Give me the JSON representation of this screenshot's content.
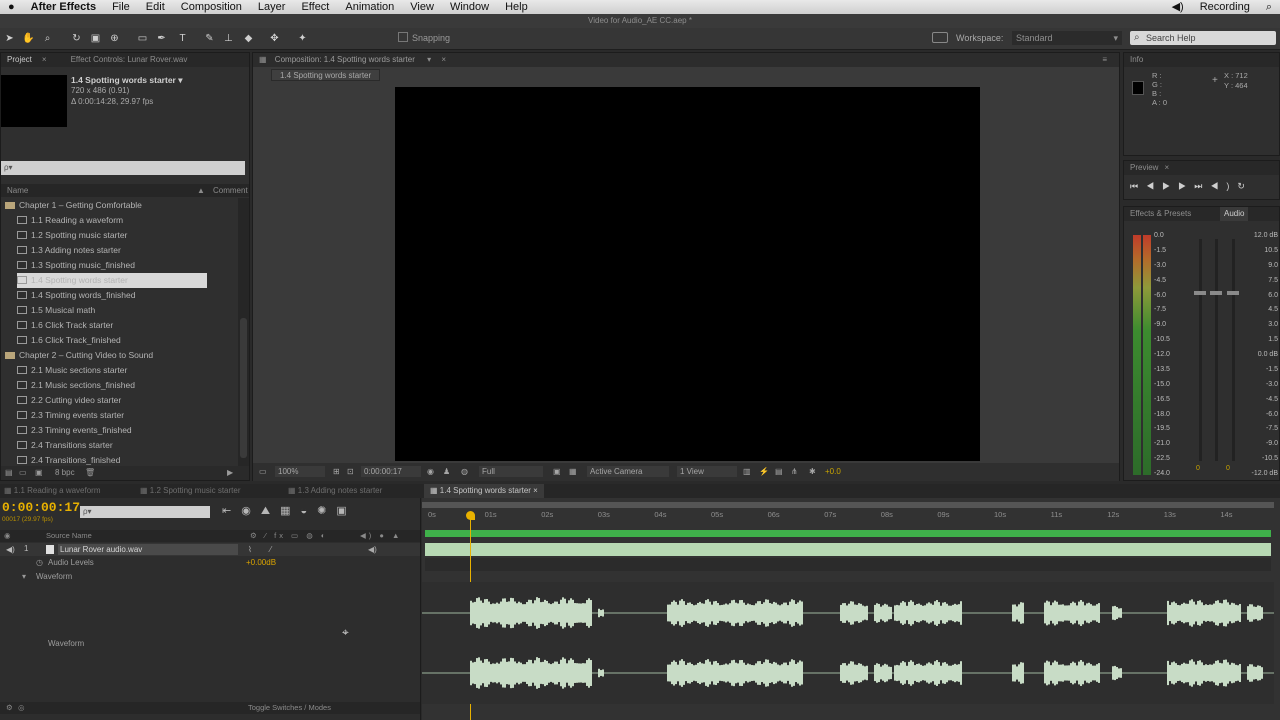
{
  "menu": {
    "apple": "",
    "app": "After Effects",
    "file": "File",
    "edit": "Edit",
    "composition": "Composition",
    "layer": "Layer",
    "effect": "Effect",
    "animation": "Animation",
    "view": "View",
    "window": "Window",
    "help": "Help",
    "recording": "Recording"
  },
  "window_title": "Video for Audio_AE CC.aep *",
  "toolbar": {
    "snapping": "Snapping",
    "workspace_label": "Workspace:",
    "workspace_value": "Standard",
    "search_placeholder": "Search Help"
  },
  "project": {
    "tab": "Project",
    "effect_tab": "Effect Controls: Lunar Rover.wav",
    "item_name": "1.4 Spotting words starter ▾",
    "item_size": "720 x 486 (0.91)",
    "item_duration": "Δ 0:00:14:28, 29.97 fps",
    "search_placeholder": "ρ▾",
    "col_name": "Name",
    "col_comment": "Comment",
    "items": [
      {
        "label": "Chapter 1 – Getting Comfortable",
        "type": "folder"
      },
      {
        "label": "1.1 Reading a waveform",
        "type": "comp"
      },
      {
        "label": "1.2 Spotting music starter",
        "type": "comp"
      },
      {
        "label": "1.3 Adding notes starter",
        "type": "comp"
      },
      {
        "label": "1.3 Spotting music_finished",
        "type": "comp"
      },
      {
        "label": "1.4 Spotting words starter",
        "type": "comp",
        "selected": true
      },
      {
        "label": "1.4 Spotting words_finished",
        "type": "comp"
      },
      {
        "label": "1.5 Musical math",
        "type": "comp"
      },
      {
        "label": "1.6 Click Track starter",
        "type": "comp"
      },
      {
        "label": "1.6 Click Track_finished",
        "type": "comp"
      },
      {
        "label": "Chapter 2 – Cutting Video to Sound",
        "type": "folder"
      },
      {
        "label": "2.1 Music sections starter",
        "type": "comp"
      },
      {
        "label": "2.1 Music sections_finished",
        "type": "comp"
      },
      {
        "label": "2.2 Cutting video starter",
        "type": "comp"
      },
      {
        "label": "2.3 Timing events starter",
        "type": "comp"
      },
      {
        "label": "2.3 Timing events_finished",
        "type": "comp"
      },
      {
        "label": "2.4 Transitions starter",
        "type": "comp"
      },
      {
        "label": "2.4 Transitions_finished",
        "type": "comp"
      }
    ],
    "bpc": "8 bpc"
  },
  "composition": {
    "tab": "Composition: 1.4 Spotting words starter",
    "subtab": "1.4 Spotting words starter",
    "zoom": "100%",
    "timecode": "0:00:00:17",
    "resolution": "Full",
    "camera": "Active Camera",
    "views": "1 View",
    "exposure": "+0.0"
  },
  "info": {
    "tab": "Info",
    "r": "R :",
    "g": "G :",
    "b": "B :",
    "a": "A : 0",
    "x": "X : 712",
    "y": "Y : 464"
  },
  "preview": {
    "tab": "Preview"
  },
  "audio": {
    "tab_effects": "Effects & Presets",
    "tab_audio": "Audio",
    "left_scale": [
      "0.0",
      "-1.5",
      "-3.0",
      "-4.5",
      "-6.0",
      "-7.5",
      "-9.0",
      "-10.5",
      "-12.0",
      "-13.5",
      "-15.0",
      "-16.5",
      "-18.0",
      "-19.5",
      "-21.0",
      "-22.5",
      "-24.0"
    ],
    "right_scale": [
      "12.0 dB",
      "10.5",
      "9.0",
      "7.5",
      "6.0",
      "4.5",
      "3.0",
      "1.5",
      "0.0 dB",
      "-1.5",
      "-3.0",
      "-4.5",
      "-6.0",
      "-7.5",
      "-9.0",
      "-10.5",
      "-12.0 dB"
    ],
    "slider_left": "0",
    "slider_right": "0"
  },
  "timeline": {
    "tabs": [
      "1.1 Reading a waveform",
      "1.2 Spotting music starter",
      "1.3 Adding notes starter",
      "1.4 Spotting words starter"
    ],
    "active_tab": 3,
    "timecode": "0:00:00:17",
    "timecode_sub": "00017 (29.97 fps)",
    "search_placeholder": "ρ▾",
    "col_source": "Source Name",
    "layer_num": "1",
    "layer_name": "Lunar Rover audio.wav",
    "audio_levels": "Audio Levels",
    "audio_levels_value": "+0.00dB",
    "waveform": "Waveform",
    "waveform_label": "Waveform",
    "toggle": "Toggle Switches / Modes",
    "ticks": [
      "0s",
      "01s",
      "02s",
      "03s",
      "04s",
      "05s",
      "06s",
      "07s",
      "08s",
      "09s",
      "10s",
      "11s",
      "12s",
      "13s",
      "14s"
    ],
    "playhead_seconds": 0.57
  },
  "colors": {
    "accent": "#e8b100",
    "bar_green": "#b7d9b3",
    "layer_green": "#3fb14a",
    "waveform": "#c8dcc6"
  }
}
